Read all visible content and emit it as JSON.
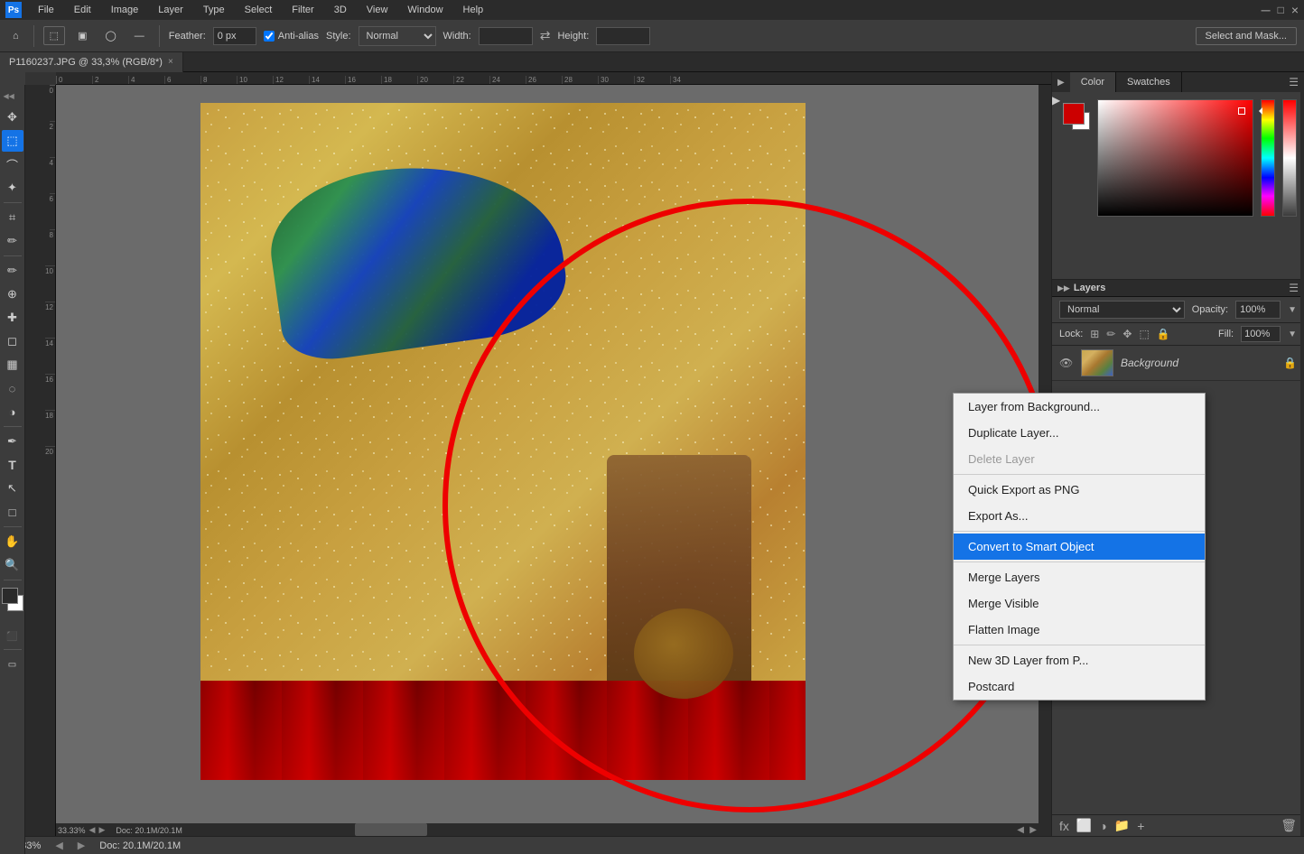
{
  "app": {
    "name": "Photoshop",
    "logo": "Ps"
  },
  "menu_bar": {
    "items": [
      "PS",
      "File",
      "Edit",
      "Image",
      "Layer",
      "Type",
      "Select",
      "Filter",
      "3D",
      "View",
      "Window",
      "Help"
    ]
  },
  "toolbar": {
    "feather_label": "Feather:",
    "feather_value": "0 px",
    "anti_alias_label": "Anti-alias",
    "style_label": "Style:",
    "style_value": "Normal",
    "width_label": "Width:",
    "height_label": "Height:",
    "select_mask_btn": "Select and Mask...",
    "icons": [
      "home",
      "marquee",
      "square",
      "rounded",
      "ellipse",
      "expand"
    ]
  },
  "tab": {
    "title": "P1160237.JPG @ 33,3% (RGB/8*)",
    "close": "×"
  },
  "status": {
    "zoom": "33.33%",
    "doc": "Doc: 20.1M/20.1M"
  },
  "panels": {
    "color_tab": "Color",
    "swatches_tab": "Swatches"
  },
  "layers": {
    "mode": "Normal",
    "opacity_label": "Opacity:",
    "opacity_value": "100%",
    "lock_label": "Lock:",
    "fill_label": "Fill:",
    "fill_value": "100%",
    "items": [
      {
        "name": "Background",
        "visible": true,
        "locked": true
      }
    ]
  },
  "context_menu": {
    "items": [
      {
        "id": "layer-from-bg",
        "label": "Layer from Background...",
        "disabled": false,
        "active": false
      },
      {
        "id": "duplicate-layer",
        "label": "Duplicate Layer...",
        "disabled": false,
        "active": false
      },
      {
        "id": "delete-layer",
        "label": "Delete Layer",
        "disabled": true,
        "active": false
      },
      {
        "id": "separator1",
        "type": "sep"
      },
      {
        "id": "quick-export",
        "label": "Quick Export as PNG",
        "disabled": false,
        "active": false
      },
      {
        "id": "export-as",
        "label": "Export As...",
        "disabled": false,
        "active": false
      },
      {
        "id": "separator2",
        "type": "sep"
      },
      {
        "id": "convert-smart",
        "label": "Convert to Smart Object",
        "disabled": false,
        "active": true
      },
      {
        "id": "separator3",
        "type": "sep"
      },
      {
        "id": "merge-layers",
        "label": "Merge Layers",
        "disabled": false,
        "active": false
      },
      {
        "id": "merge-visible",
        "label": "Merge Visible",
        "disabled": false,
        "active": false
      },
      {
        "id": "flatten",
        "label": "Flatten Image",
        "disabled": false,
        "active": false
      },
      {
        "id": "separator4",
        "type": "sep"
      },
      {
        "id": "new-3d",
        "label": "New 3D Layer from P...",
        "disabled": false,
        "active": false
      },
      {
        "id": "postcard",
        "label": "Postcard",
        "disabled": false,
        "active": false
      }
    ]
  },
  "tools": {
    "items": [
      {
        "id": "move",
        "icon": "✥",
        "active": false
      },
      {
        "id": "marquee",
        "icon": "⬚",
        "active": true
      },
      {
        "id": "lasso",
        "icon": "⌒",
        "active": false
      },
      {
        "id": "magic",
        "icon": "✦",
        "active": false
      },
      {
        "id": "crop",
        "icon": "⌗",
        "active": false
      },
      {
        "id": "eyedropper",
        "icon": "✏",
        "active": false
      },
      {
        "id": "brush",
        "icon": "✏",
        "active": false
      },
      {
        "id": "clone",
        "icon": "⊕",
        "active": false
      },
      {
        "id": "healing",
        "icon": "✚",
        "active": false
      },
      {
        "id": "eraser",
        "icon": "◻",
        "active": false
      },
      {
        "id": "gradient",
        "icon": "▦",
        "active": false
      },
      {
        "id": "blur",
        "icon": "◌",
        "active": false
      },
      {
        "id": "dodge",
        "icon": "◑",
        "active": false
      },
      {
        "id": "pen",
        "icon": "✒",
        "active": false
      },
      {
        "id": "type",
        "icon": "T",
        "active": false
      },
      {
        "id": "path",
        "icon": "↖",
        "active": false
      },
      {
        "id": "shape",
        "icon": "□",
        "active": false
      },
      {
        "id": "hand",
        "icon": "✋",
        "active": false
      },
      {
        "id": "zoom",
        "icon": "🔍",
        "active": false
      }
    ]
  }
}
